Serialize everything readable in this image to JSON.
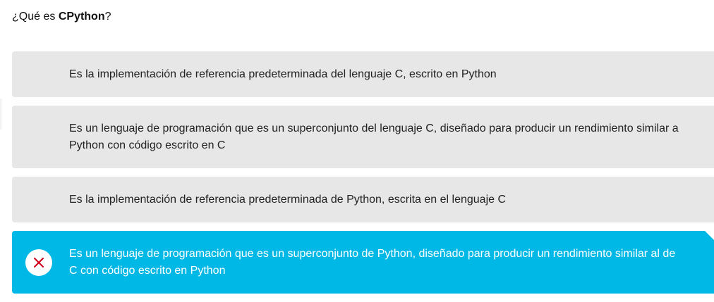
{
  "question": {
    "prefix": "¿Qué es ",
    "term": "CPython",
    "suffix": "?"
  },
  "options": [
    {
      "text": "Es la implementación de referencia predeterminada del lenguaje C, escrito en Python",
      "state": "unselected"
    },
    {
      "text": "Es un lenguaje de programación que es un superconjunto del lenguaje C, diseñado para producir un rendimiento similar a Python con código escrito en C",
      "state": "unselected"
    },
    {
      "text": "Es la implementación de referencia predeterminada de Python, escrita en el lenguaje C",
      "state": "unselected"
    },
    {
      "text": "Es un lenguaje de programación que es un superconjunto de Python, diseñado para producir un rendimiento similar al de C con código escrito en Python",
      "state": "selected-incorrect",
      "icon": "close-icon"
    }
  ],
  "colors": {
    "selected_bg": "#00b8e6",
    "option_bg": "#e7e7e7",
    "incorrect_mark": "#d0021b"
  }
}
